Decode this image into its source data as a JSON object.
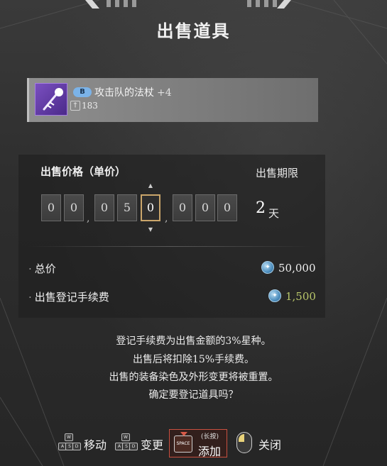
{
  "title": "出售道具",
  "item": {
    "grade": "B",
    "name": "攻击队的法杖",
    "enhance": "+4",
    "power": "183",
    "icon": "staff-item-icon"
  },
  "price": {
    "label": "出售价格（单价）",
    "digits": [
      "0",
      "0",
      "0",
      "5",
      "0",
      "0",
      "0",
      "0"
    ],
    "separator": ",",
    "period_label": "出售期限",
    "period_value": "2",
    "period_unit": "天"
  },
  "summary": {
    "total_label": "总价",
    "total_value": "50,000",
    "fee_label": "出售登记手续费",
    "fee_value": "1,500",
    "currency_icon": "star-coin-icon",
    "fee_color": "#b9c76a"
  },
  "notice": [
    "登记手续费为出售金额的3%星种。",
    "出售后将扣除15%手续费。",
    "出售的装备染色及外形变更将被重置。",
    "确定要登记道具吗？"
  ],
  "controls": {
    "move_label": "移动",
    "change_label": "变更",
    "space_key": "SPACE",
    "hold_hint": "(长按)",
    "add_label": "添加",
    "close_label": "关闭",
    "wasd_keys": [
      "W",
      "A",
      "S",
      "D"
    ]
  },
  "colors": {
    "accent": "#c9a56a",
    "confirm_border": "#c85040",
    "currency": "#4e8fbf"
  }
}
